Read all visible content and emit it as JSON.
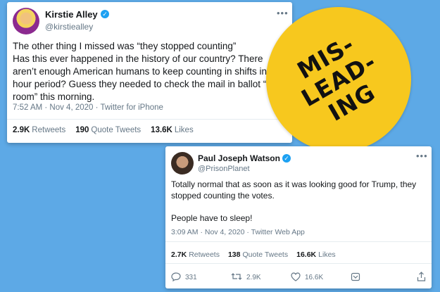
{
  "tweet1": {
    "name": "Kirstie Alley",
    "handle": "@kirstiealley",
    "text": "The other thing I missed was “they stopped counting”\nHas this ever happened in the history of our country? There aren’t enough American humans to keep counting in shifts in a 24 hour period? Guess they needed to check the mail in ballot “stock room” this morning.",
    "meta": "7:52 AM · Nov 4, 2020 · Twitter for iPhone",
    "retweets_count": "2.9K",
    "retweets_label": "Retweets",
    "quotes_count": "190",
    "quotes_label": "Quote Tweets",
    "likes_count": "13.6K",
    "likes_label": "Likes"
  },
  "tweet2": {
    "name": "Paul Joseph Watson",
    "handle": "@PrisonPlanet",
    "text": "Totally normal that as soon as it was looking good for Trump, they stopped counting the votes.\n\nPeople have to sleep!",
    "meta": "3:09 AM · Nov 4, 2020 · Twitter Web App",
    "retweets_count": "2.7K",
    "retweets_label": "Retweets",
    "quotes_count": "138",
    "quotes_label": "Quote Tweets",
    "likes_count": "16.6K",
    "likes_label": "Likes",
    "reply_count": "331",
    "retweet_action_count": "2.9K",
    "like_action_count": "16.6K"
  },
  "badge": {
    "line1": "MIS-",
    "line2": "LEAD-",
    "line3": "ING"
  },
  "icons": {
    "verified": "verified-icon",
    "more": "more-icon",
    "reply": "reply-icon",
    "retweet": "retweet-icon",
    "like": "like-icon",
    "share": "share-icon"
  },
  "colors": {
    "background": "#5da9e6",
    "badge": "#f7c81e",
    "verified": "#1da1f2"
  }
}
